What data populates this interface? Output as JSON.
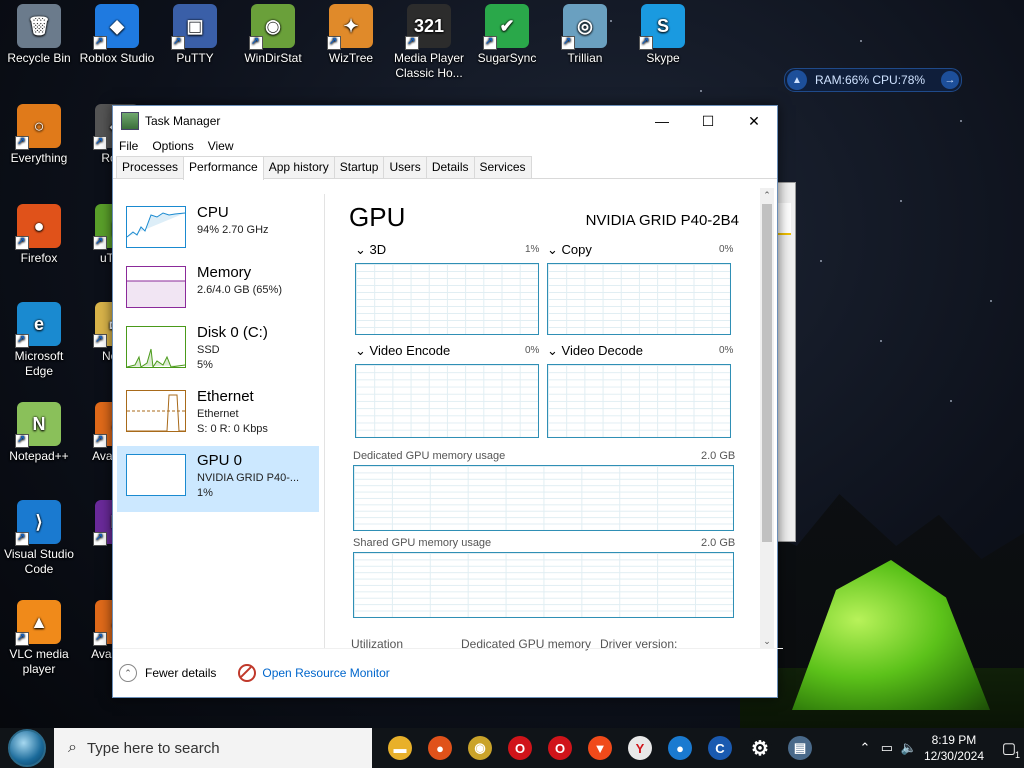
{
  "desktop": {
    "icons": [
      {
        "label": "Recycle Bin",
        "color": "#6b7b8c",
        "glyph": "🗑"
      },
      {
        "label": "Roblox Studio",
        "color": "#1f7ae0",
        "glyph": "◆"
      },
      {
        "label": "PuTTY",
        "color": "#3a5fa8",
        "glyph": "▣"
      },
      {
        "label": "WinDirStat",
        "color": "#6aa03a",
        "glyph": "◉"
      },
      {
        "label": "WizTree",
        "color": "#e08a2a",
        "glyph": "✦"
      },
      {
        "label": "Media Player Classic Ho...",
        "color": "#2c2c2c",
        "glyph": "321"
      },
      {
        "label": "SugarSync",
        "color": "#2aa84a",
        "glyph": "✔"
      },
      {
        "label": "Trillian",
        "color": "#6aa0c0",
        "glyph": "◎"
      },
      {
        "label": "Skype",
        "color": "#1a9ae0",
        "glyph": "S"
      },
      {
        "label": "Everything",
        "color": "#e07a1a",
        "glyph": "○"
      },
      {
        "label": "Roblo",
        "color": "#555555",
        "glyph": "◆"
      },
      {
        "label": "Firefox",
        "color": "#e0521a",
        "glyph": "●"
      },
      {
        "label": "uTorre",
        "color": "#5aa02a",
        "glyph": "μ"
      },
      {
        "label": "Microsoft Edge",
        "color": "#1a8ad0",
        "glyph": "e"
      },
      {
        "label": "Nowy",
        "color": "#d9b44a",
        "glyph": "▭"
      },
      {
        "label": "Notepad++",
        "color": "#8ac05a",
        "glyph": "N"
      },
      {
        "label": "Avas Anti",
        "color": "#e06a1a",
        "glyph": "a"
      },
      {
        "label": "Visual Studio Code",
        "color": "#1a7ad0",
        "glyph": "⟩"
      },
      {
        "label": "N",
        "color": "#6a2a9a",
        "glyph": "N"
      },
      {
        "label": "VLC media player",
        "color": "#f08a1a",
        "glyph": "▲"
      },
      {
        "label": "Avast Bro",
        "color": "#e06a1a",
        "glyph": "a"
      }
    ]
  },
  "widget": {
    "text": "RAM:66%  CPU:78%"
  },
  "bg_window": {
    "text": "ory."
  },
  "taskmanager": {
    "title": "Task Manager",
    "controls": {
      "minimize": "—",
      "maximize": "☐",
      "close": "✕"
    },
    "menu": [
      "File",
      "Options",
      "View"
    ],
    "tabs": [
      "Processes",
      "Performance",
      "App history",
      "Startup",
      "Users",
      "Details",
      "Services"
    ],
    "resources": [
      {
        "name": "CPU",
        "sub1": "94%  2.70 GHz",
        "sub2": "",
        "sub3": ""
      },
      {
        "name": "Memory",
        "sub1": "2.6/4.0 GB (65%)",
        "sub2": "",
        "sub3": ""
      },
      {
        "name": "Disk 0 (C:)",
        "sub1": "SSD",
        "sub2": "5%",
        "sub3": ""
      },
      {
        "name": "Ethernet",
        "sub1": "Ethernet",
        "sub2": "S: 0  R: 0 Kbps",
        "sub3": ""
      },
      {
        "name": "GPU 0",
        "sub1": "NVIDIA GRID P40-...",
        "sub2": "1%",
        "sub3": ""
      }
    ],
    "gpu": {
      "title": "GPU",
      "model": "NVIDIA GRID P40-2B4",
      "engines": [
        {
          "label": "3D",
          "pct": "1%"
        },
        {
          "label": "Copy",
          "pct": "0%"
        },
        {
          "label": "Video Encode",
          "pct": "0%"
        },
        {
          "label": "Video Decode",
          "pct": "0%"
        }
      ],
      "dedicated_label": "Dedicated GPU memory usage",
      "dedicated_value": "2.0 GB",
      "shared_label": "Shared GPU memory usage",
      "shared_value": "2.0 GB",
      "stats": [
        "Utilization",
        "Dedicated GPU memory",
        "Driver version:"
      ]
    },
    "footer": {
      "fewer": "Fewer details",
      "monitor": "Open Resource Monitor"
    }
  },
  "taskbar": {
    "search_placeholder": "Type here to search",
    "apps": [
      {
        "name": "file-explorer",
        "color": "#e8b02a",
        "glyph": "▬"
      },
      {
        "name": "firefox",
        "color": "#e0521a",
        "glyph": "●"
      },
      {
        "name": "brave-like",
        "color": "#caa32a",
        "glyph": "◉"
      },
      {
        "name": "opera",
        "color": "#d0141a",
        "glyph": "O"
      },
      {
        "name": "opera-gx",
        "color": "#d0141a",
        "glyph": "O"
      },
      {
        "name": "brave",
        "color": "#f04a1a",
        "glyph": "▼"
      },
      {
        "name": "yandex",
        "color": "#e8e8e8",
        "glyph": "Y"
      },
      {
        "name": "browser-blue",
        "color": "#1a7ad0",
        "glyph": "●"
      },
      {
        "name": "ccleaner",
        "color": "#1a5ab0",
        "glyph": "C"
      },
      {
        "name": "settings",
        "color": "#101418",
        "glyph": "⚙"
      },
      {
        "name": "task-manager",
        "color": "#4a6a8a",
        "glyph": "▤"
      }
    ],
    "time": "8:19 PM",
    "date": "12/30/2024",
    "notification_count": "1"
  }
}
